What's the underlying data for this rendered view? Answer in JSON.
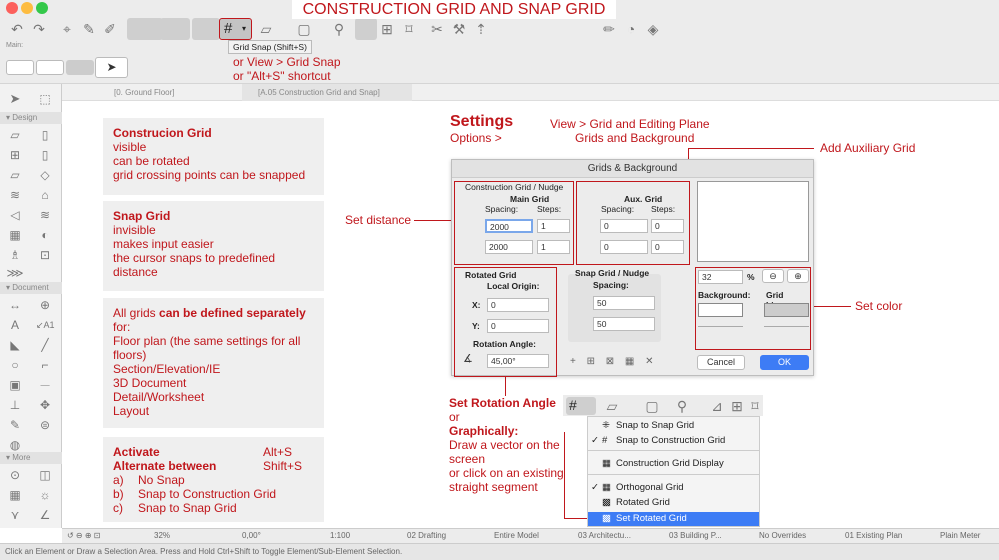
{
  "title": "CONSTRUCTION GRID AND SNAP GRID",
  "toolbar": {
    "tooltip": "Grid Snap (Shift+S)",
    "main_label": "Main:",
    "hint1": "or View > Grid Snap",
    "hint2": "or \"Alt+S\" shortcut"
  },
  "tabs": [
    "[0. Ground Floor]",
    "[A.05 Construction Grid and Snap]"
  ],
  "sidebar": {
    "sections": [
      "Design",
      "Document",
      "More"
    ]
  },
  "boxes": {
    "b1": {
      "title": "Construcion Grid",
      "lines": [
        "visible",
        "can be rotated",
        "grid crossing points can be snapped"
      ]
    },
    "b2": {
      "title": "Snap Grid",
      "lines": [
        "invisible",
        "makes input easier",
        "the cursor snaps to predefined distance"
      ]
    },
    "b3": {
      "pre": "All grids ",
      "bold": "can be defined separately",
      "post": " for:",
      "lines": [
        "Floor plan (the same settings for all floors)",
        "Section/Elevation/IE",
        "3D Document",
        "Detail/Worksheet",
        "Layout"
      ]
    },
    "b4": {
      "title": "Activate",
      "key1": "Alt+S",
      "sub": "Alternate between",
      "key2": "Shift+S",
      "items": [
        [
          "a)",
          "No Snap"
        ],
        [
          "b)",
          "Snap to Construction Grid"
        ],
        [
          "c)",
          "Snap to Snap Grid"
        ]
      ]
    }
  },
  "annotations": {
    "settings": "Settings",
    "options": "Options >",
    "view_path": "View > Grid and Editing Plane",
    "grids_bg": "Grids and Background",
    "add_aux": "Add Auxiliary Grid",
    "set_distance": "Set distance",
    "set_color": "Set color",
    "set_rotation": "Set Rotation Angle",
    "or": "or",
    "graphically": "Graphically",
    "graph_lines": [
      "Draw a vector on the screen",
      "or click on an existing straight segment"
    ]
  },
  "dialog": {
    "title": "Grids & Background",
    "cg_title": "Construction Grid / Nudge",
    "main_grid": "Main Grid",
    "spacing": "Spacing:",
    "steps": "Steps:",
    "main_x": "2000",
    "main_x_steps": "1",
    "main_y": "2000",
    "main_y_steps": "1",
    "aux_grid": "Aux. Grid",
    "aux_x": "0",
    "aux_x_steps": "0",
    "aux_y": "0",
    "aux_y_steps": "0",
    "rot_title": "Rotated Grid",
    "local_origin": "Local Origin:",
    "x_label": "X:",
    "y_label": "Y:",
    "x_val": "0",
    "y_val": "0",
    "rot_angle_label": "Rotation Angle:",
    "rot_angle": "45,00°",
    "snap_title": "Snap Grid / Nudge",
    "snap_x": "50",
    "snap_y": "50",
    "zoom": "32",
    "pct": "%",
    "background": "Background:",
    "grid_lines": "Grid Lines:",
    "cancel": "Cancel",
    "ok": "OK"
  },
  "menu": {
    "items": [
      "Snap to Snap Grid",
      "Snap to Construction Grid",
      "Construction Grid Display",
      "Orthogonal Grid",
      "Rotated Grid",
      "Set Rotated Grid"
    ]
  },
  "status": {
    "zoom": "32%",
    "angle": "0,00°",
    "scale": "1:100",
    "layer": "02 Drafting",
    "model": "Entire Model",
    "pen": "03 Architectu...",
    "mvo": "03 Building P...",
    "overrides": "No Overrides",
    "reno": "01 Existing Plan",
    "dim": "Plain Meter",
    "info": "Click an Element or Draw a Selection Area. Press and Hold Ctrl+Shift to Toggle Element/Sub-Element Selection."
  },
  "colors": {
    "accent": "#c0171c",
    "selected": "#3d7cf5"
  }
}
